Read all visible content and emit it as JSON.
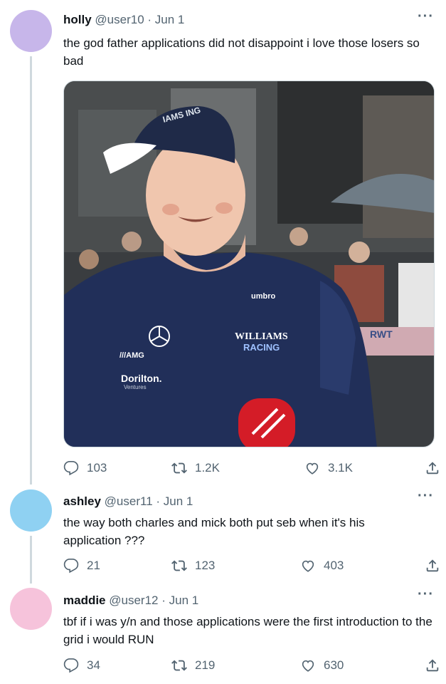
{
  "tweets": [
    {
      "display_name": "holly",
      "handle": "@user10",
      "sep": "·",
      "date": "Jun 1",
      "text": "the god father applications did not disappoint i love those losers so bad",
      "avatar_color": "#c7b6ea",
      "replies": "103",
      "retweets": "1.2K",
      "likes": "3.1K"
    },
    {
      "display_name": "ashley",
      "handle": "@user11",
      "sep": "·",
      "date": "Jun 1",
      "text": "the way both charles and mick both put seb when it's his application ???",
      "avatar_color": "#8fd1f2",
      "replies": "21",
      "retweets": "123",
      "likes": "403"
    },
    {
      "display_name": "maddie",
      "handle": "@user12",
      "sep": "·",
      "date": "Jun 1",
      "text": "tbf if i was y/n and those applications were the first introduction to the grid i would RUN",
      "avatar_color": "#f6c3db",
      "replies": "34",
      "retweets": "219",
      "likes": "630"
    }
  ],
  "more_glyph": "···",
  "media": {
    "cap_text": "IAMS ING",
    "shirt_brand": "umbro",
    "shirt_team_line1": "WILLIAMS",
    "shirt_team_line2": "RACING",
    "sponsor_amg": "///AMG",
    "sponsor_dorilton": "Dorilton.",
    "sponsor_ventures": "Ventures",
    "background_sign": "RWT"
  },
  "icons": {
    "reply": "reply-icon",
    "retweet": "retweet-icon",
    "like": "like-icon",
    "share": "share-icon",
    "more": "more-icon"
  }
}
